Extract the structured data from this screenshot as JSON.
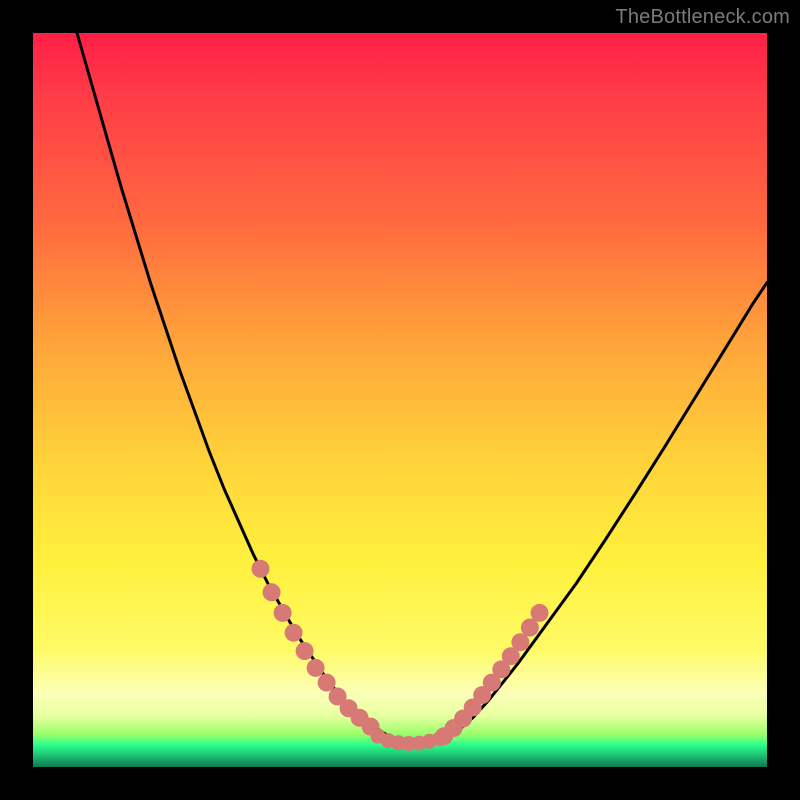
{
  "watermark": "TheBottleneck.com",
  "colors": {
    "frame": "#000000",
    "curve": "#000000",
    "salmon": "#d77a76",
    "watermark_text": "#7b7b7b"
  },
  "chart_data": {
    "type": "line",
    "title": "",
    "xlabel": "",
    "ylabel": "",
    "xlim": [
      0,
      100
    ],
    "ylim": [
      0,
      100
    ],
    "note": "No axis tick labels are visible; x and y are normalized to plot-area percentage (0=left/bottom, 100=right/top).",
    "series": [
      {
        "name": "curve",
        "x": [
          6,
          8,
          10,
          12,
          14,
          16,
          18,
          20,
          22,
          24,
          26,
          28,
          30,
          32,
          34,
          36,
          38,
          40,
          42,
          44,
          46,
          48,
          50,
          52,
          54,
          56,
          58,
          60,
          62,
          66,
          70,
          74,
          78,
          82,
          86,
          90,
          94,
          98,
          100
        ],
        "y": [
          100,
          93,
          86,
          79,
          72.5,
          66,
          60,
          54,
          48.5,
          43,
          38,
          33.5,
          29,
          25,
          21.5,
          18,
          15,
          12,
          9.5,
          7.5,
          5.8,
          4.5,
          3.5,
          3.2,
          3.2,
          3.8,
          5,
          6.8,
          9,
          14,
          19.5,
          25,
          31,
          37.2,
          43.5,
          50,
          56.5,
          63,
          66
        ]
      }
    ],
    "highlights": [
      {
        "name": "descending-segment",
        "x": [
          31,
          32.5,
          34,
          35.5,
          37,
          38.5,
          40,
          41.5,
          43,
          44.5,
          46
        ],
        "y": [
          27,
          23.8,
          21,
          18.3,
          15.8,
          13.5,
          11.5,
          9.6,
          8,
          6.7,
          5.5
        ]
      },
      {
        "name": "ascending-segment",
        "x": [
          56,
          57.3,
          58.6,
          59.9,
          61.2,
          62.5,
          63.8,
          65.1,
          66.4,
          67.7,
          69
        ],
        "y": [
          4.2,
          5.3,
          6.6,
          8.1,
          9.8,
          11.5,
          13.3,
          15.1,
          17,
          19,
          21
        ]
      },
      {
        "name": "bottom-flat",
        "x": [
          47,
          48.4,
          49.8,
          51.2,
          52.6,
          54,
          55.4
        ],
        "y": [
          4.2,
          3.6,
          3.3,
          3.2,
          3.25,
          3.5,
          3.85
        ]
      }
    ]
  }
}
